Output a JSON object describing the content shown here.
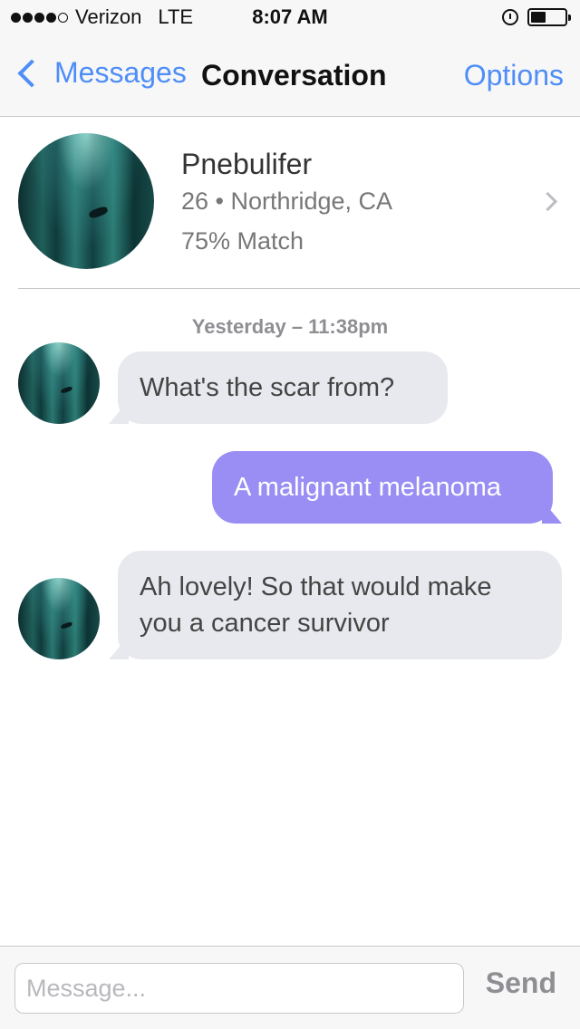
{
  "status_bar": {
    "signal_bars": 4,
    "carrier": "Verizon",
    "network": "LTE",
    "time": "8:07 AM",
    "battery_level": 0.45
  },
  "nav": {
    "back_label": "Messages",
    "title": "Conversation",
    "options_label": "Options",
    "accent_color": "#4f8ef7"
  },
  "profile": {
    "name": "Pnebulifer",
    "details": "26 • Northridge, CA",
    "match": "75% Match"
  },
  "conversation": {
    "timestamp": "Yesterday – 11:38pm",
    "messages": [
      {
        "direction": "incoming",
        "text": "What's the scar from?"
      },
      {
        "direction": "outgoing",
        "text": "A malignant melanoma"
      },
      {
        "direction": "incoming",
        "text": "Ah lovely! So that would make you a cancer survivor"
      }
    ],
    "colors": {
      "incoming": "#e8e9ee",
      "outgoing": "#9a8ef5"
    }
  },
  "composer": {
    "value": "",
    "placeholder": "Message...",
    "send_label": "Send"
  }
}
